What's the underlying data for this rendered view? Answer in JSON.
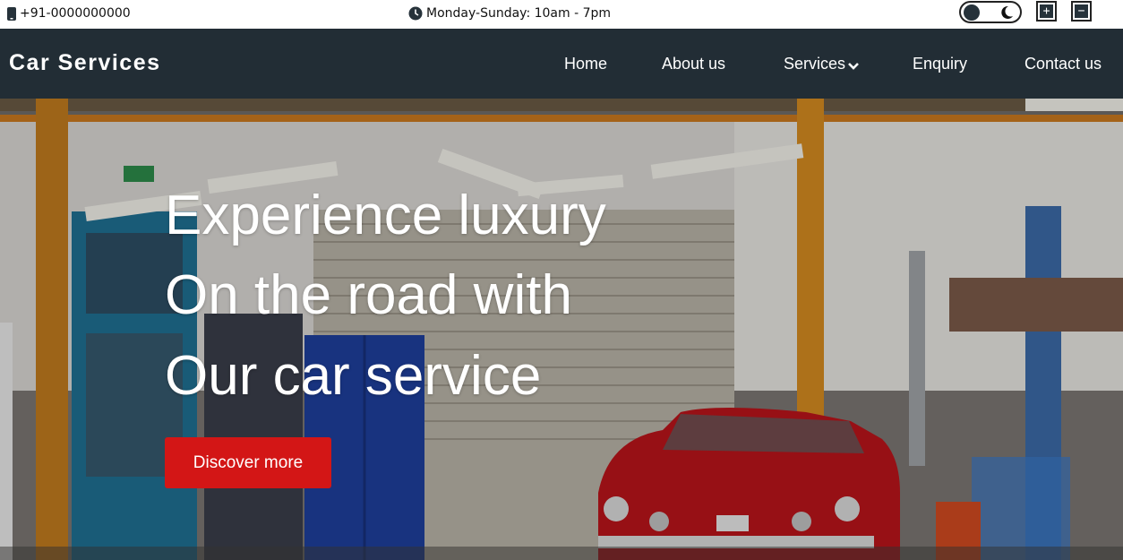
{
  "topbar": {
    "phone": "+91-0000000000",
    "hours": "Monday-Sunday: 10am - 7pm",
    "zoom_in_label": "+",
    "zoom_out_label": "−"
  },
  "navbar": {
    "brand": "Car Services",
    "links": [
      {
        "label": "Home"
      },
      {
        "label": "About us"
      },
      {
        "label": "Services"
      },
      {
        "label": "Enquiry"
      },
      {
        "label": "Contact us"
      }
    ]
  },
  "hero": {
    "lines": [
      "Experience luxury",
      "On the road with",
      "Our car service"
    ],
    "cta_label": "Discover more"
  },
  "colors": {
    "navbar_bg": "#222d35",
    "cta_bg": "#d31616",
    "text_light": "#ffffff"
  },
  "icons": [
    "phone-icon",
    "clock-icon",
    "moon-icon",
    "chevron-down-icon"
  ]
}
